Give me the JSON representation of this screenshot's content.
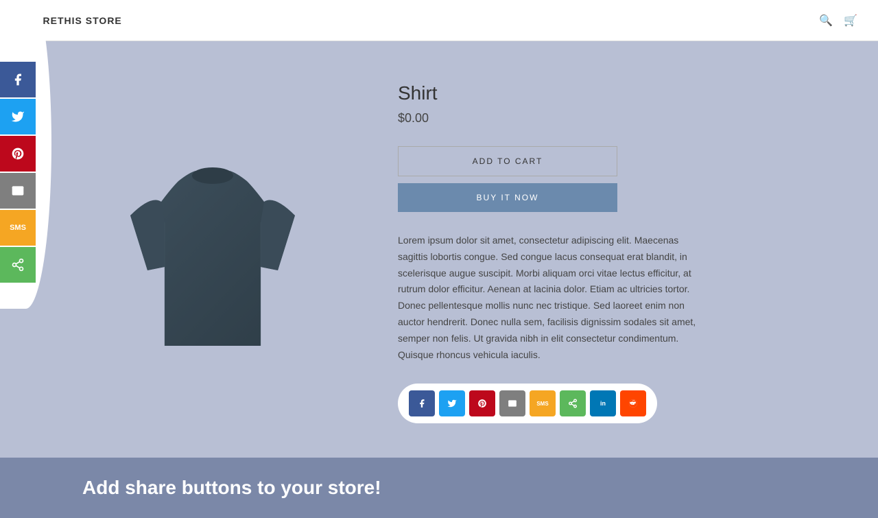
{
  "header": {
    "logo": "SHARETHIS STORE",
    "search_label": "Search",
    "cart_label": "Cart"
  },
  "social_sidebar": {
    "buttons": [
      {
        "id": "facebook",
        "class": "facebook",
        "icon": "f",
        "label": "Share on Facebook"
      },
      {
        "id": "twitter",
        "class": "twitter",
        "icon": "t",
        "label": "Share on Twitter"
      },
      {
        "id": "pinterest",
        "class": "pinterest",
        "icon": "p",
        "label": "Share on Pinterest"
      },
      {
        "id": "email",
        "class": "email",
        "icon": "✉",
        "label": "Share via Email"
      },
      {
        "id": "sms",
        "class": "sms",
        "icon": "SMS",
        "label": "Share via SMS"
      },
      {
        "id": "share",
        "class": "share",
        "icon": "<",
        "label": "Share"
      }
    ]
  },
  "product": {
    "title": "Shirt",
    "price": "$0.00",
    "add_to_cart_label": "ADD TO CART",
    "buy_now_label": "BUY IT NOW",
    "description": "Lorem ipsum dolor sit amet, consectetur adipiscing elit. Maecenas sagittis lobortis congue. Sed congue lacus consequat erat blandit, in scelerisque augue suscipit. Morbi aliquam orci vitae lectus efficitur, at rutrum dolor efficitur. Aenean at lacinia dolor. Etiam ac ultricies tortor. Donec pellentesque mollis nunc nec tristique. Sed laoreet enim non auctor hendrerit. Donec nulla sem, facilisis dignissim sodales sit amet, semper non felis. Ut gravida nibh in elit consectetur condimentum. Quisque rhoncus vehicula iaculis."
  },
  "share_row": {
    "buttons": [
      {
        "class": "si-facebook",
        "icon": "f",
        "label": "Facebook"
      },
      {
        "class": "si-twitter",
        "icon": "t",
        "label": "Twitter"
      },
      {
        "class": "si-pinterest",
        "icon": "p",
        "label": "Pinterest"
      },
      {
        "class": "si-email",
        "icon": "✉",
        "label": "Email"
      },
      {
        "class": "si-sms",
        "icon": "⬛",
        "label": "SMS"
      },
      {
        "class": "si-sharethis",
        "icon": "<",
        "label": "ShareThis"
      },
      {
        "class": "si-linkedin",
        "icon": "in",
        "label": "LinkedIn"
      },
      {
        "class": "si-reddit",
        "icon": "r",
        "label": "Reddit"
      }
    ]
  },
  "banner": {
    "text": "Add share buttons to your store!"
  }
}
